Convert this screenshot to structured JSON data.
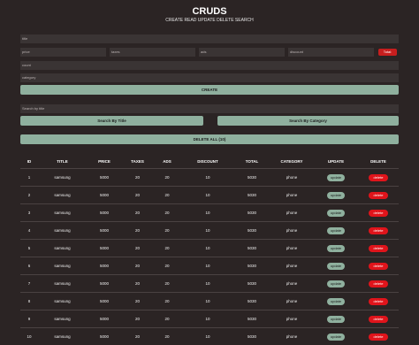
{
  "header": {
    "title": "CRUDS",
    "subtitle": "CREATE READ UPDATE DELETE SEARCH"
  },
  "form": {
    "title_placeholder": "title",
    "price_placeholder": "price",
    "taxes_placeholder": "taxes",
    "ads_placeholder": "ads",
    "discount_placeholder": "discount",
    "total_label": "Total:",
    "count_placeholder": "count",
    "category_placeholder": "category",
    "create_label": "CREATE"
  },
  "search": {
    "placeholder": "Search by title",
    "by_title_label": "Search By Title",
    "by_category_label": "Search By Category",
    "delete_all_label": "DELETE ALL (10)"
  },
  "table": {
    "headers": [
      "ID",
      "TITLE",
      "PRICE",
      "TAXES",
      "ADS",
      "DISCOUNT",
      "TOTAL",
      "CATEGORY",
      "UPDATE",
      "DELETE"
    ],
    "update_label": "update",
    "delete_label": "delete",
    "rows": [
      {
        "id": "1",
        "title": "samsung",
        "price": "5000",
        "taxes": "20",
        "ads": "20",
        "discount": "10",
        "total": "5030",
        "category": "phone"
      },
      {
        "id": "2",
        "title": "samsung",
        "price": "5000",
        "taxes": "20",
        "ads": "20",
        "discount": "10",
        "total": "5030",
        "category": "phone"
      },
      {
        "id": "3",
        "title": "samsung",
        "price": "5000",
        "taxes": "20",
        "ads": "20",
        "discount": "10",
        "total": "5030",
        "category": "phone"
      },
      {
        "id": "4",
        "title": "samsung",
        "price": "5000",
        "taxes": "20",
        "ads": "20",
        "discount": "10",
        "total": "5030",
        "category": "phone"
      },
      {
        "id": "5",
        "title": "samsung",
        "price": "5000",
        "taxes": "20",
        "ads": "20",
        "discount": "10",
        "total": "5030",
        "category": "phone"
      },
      {
        "id": "6",
        "title": "samsung",
        "price": "5000",
        "taxes": "20",
        "ads": "20",
        "discount": "10",
        "total": "5030",
        "category": "phone"
      },
      {
        "id": "7",
        "title": "samsung",
        "price": "5000",
        "taxes": "20",
        "ads": "20",
        "discount": "10",
        "total": "5030",
        "category": "phone"
      },
      {
        "id": "8",
        "title": "samsung",
        "price": "5000",
        "taxes": "20",
        "ads": "20",
        "discount": "10",
        "total": "5030",
        "category": "phone"
      },
      {
        "id": "9",
        "title": "samsung",
        "price": "5000",
        "taxes": "20",
        "ads": "20",
        "discount": "10",
        "total": "5030",
        "category": "phone"
      },
      {
        "id": "10",
        "title": "samsung",
        "price": "5000",
        "taxes": "20",
        "ads": "20",
        "discount": "10",
        "total": "5030",
        "category": "phone"
      }
    ]
  }
}
